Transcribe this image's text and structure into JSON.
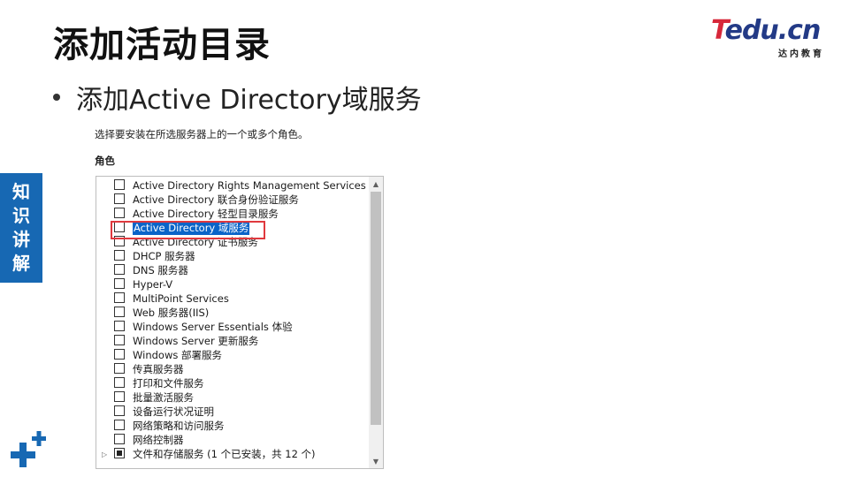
{
  "slide": {
    "title": "添加活动目录",
    "bullet": "添加Active Directory域服务",
    "side_tab": [
      "知",
      "识",
      "讲",
      "解"
    ]
  },
  "logo": {
    "main_first": "T",
    "main_rest": "edu.cn",
    "sub": "达内教育",
    "colors": {
      "t": "#d7283a",
      "rest": "#233a86"
    }
  },
  "dialog": {
    "instruction": "选择要安装在所选服务器上的一个或多个角色。",
    "roles_label": "角色",
    "roles": [
      {
        "label": "Active Directory Rights Management Services",
        "state": "unchecked"
      },
      {
        "label": "Active Directory 联合身份验证服务",
        "state": "unchecked"
      },
      {
        "label": "Active Directory 轻型目录服务",
        "state": "unchecked"
      },
      {
        "label": "Active Directory 域服务",
        "state": "unchecked",
        "selected": true
      },
      {
        "label": "Active Directory 证书服务",
        "state": "unchecked"
      },
      {
        "label": "DHCP 服务器",
        "state": "unchecked"
      },
      {
        "label": "DNS 服务器",
        "state": "unchecked"
      },
      {
        "label": "Hyper-V",
        "state": "unchecked"
      },
      {
        "label": "MultiPoint Services",
        "state": "unchecked"
      },
      {
        "label": "Web 服务器(IIS)",
        "state": "unchecked"
      },
      {
        "label": "Windows Server Essentials 体验",
        "state": "unchecked"
      },
      {
        "label": "Windows Server 更新服务",
        "state": "unchecked"
      },
      {
        "label": "Windows 部署服务",
        "state": "unchecked"
      },
      {
        "label": "传真服务器",
        "state": "unchecked"
      },
      {
        "label": "打印和文件服务",
        "state": "unchecked"
      },
      {
        "label": "批量激活服务",
        "state": "unchecked"
      },
      {
        "label": "设备运行状况证明",
        "state": "unchecked"
      },
      {
        "label": "网络策略和访问服务",
        "state": "unchecked"
      },
      {
        "label": "网络控制器",
        "state": "unchecked"
      },
      {
        "label": "文件和存储服务 (1 个已安装，共 12 个)",
        "state": "partial",
        "expandable": true
      }
    ],
    "highlight_color": "#e0393e",
    "selection_color": "#0a64c8"
  }
}
